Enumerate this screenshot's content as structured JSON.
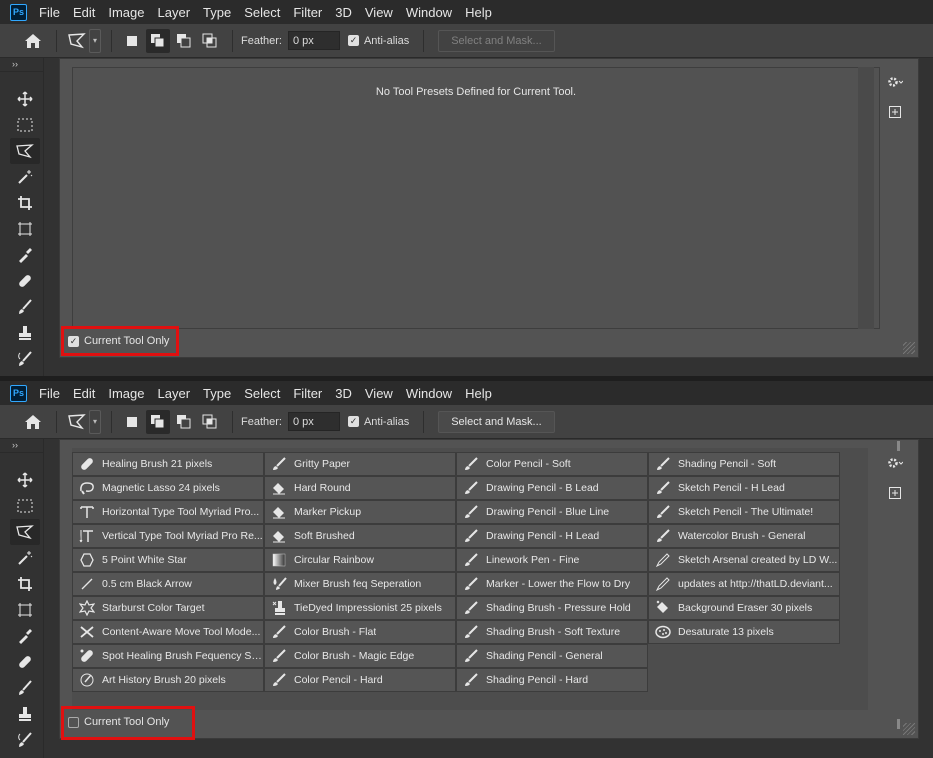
{
  "menu": [
    "File",
    "Edit",
    "Image",
    "Layer",
    "Type",
    "Select",
    "Filter",
    "3D",
    "View",
    "Window",
    "Help"
  ],
  "ps_logo": "Ps",
  "options": {
    "feather_label": "Feather:",
    "feather_value": "0 px",
    "antialias_label": "Anti-alias",
    "antialias_checked": true,
    "select_mask_label": "Select and Mask..."
  },
  "top_panel": {
    "empty_message": "No Tool Presets Defined for Current Tool.",
    "current_tool_only_label": "Current Tool Only",
    "current_tool_only_checked": true
  },
  "bottom_panel": {
    "current_tool_only_label": "Current Tool Only",
    "current_tool_only_checked": false,
    "presets": [
      {
        "label": "Healing Brush 21 pixels",
        "icon": "bandage-icon"
      },
      {
        "label": "Magnetic Lasso 24 pixels",
        "icon": "magnetic-lasso-icon"
      },
      {
        "label": "Horizontal Type Tool Myriad Pro...",
        "icon": "type-icon"
      },
      {
        "label": "Vertical Type Tool Myriad Pro Re...",
        "icon": "vertical-type-icon"
      },
      {
        "label": "5 Point White Star",
        "icon": "hexagon-icon"
      },
      {
        "label": "0.5 cm Black Arrow",
        "icon": "line-icon"
      },
      {
        "label": "Starburst Color Target",
        "icon": "starburst-icon"
      },
      {
        "label": "Content-Aware Move Tool Mode...",
        "icon": "move-cross-icon"
      },
      {
        "label": "Spot Healing Brush Fequency Se...",
        "icon": "spot-healing-icon"
      },
      {
        "label": "Art History Brush 20 pixels",
        "icon": "art-history-icon"
      },
      {
        "label": "Gritty Paper",
        "icon": "brush-icon"
      },
      {
        "label": "Hard Round",
        "icon": "eraser-icon"
      },
      {
        "label": "Marker Pickup",
        "icon": "eraser-icon"
      },
      {
        "label": "Soft Brushed",
        "icon": "eraser-icon"
      },
      {
        "label": "Circular Rainbow",
        "icon": "gradient-icon"
      },
      {
        "label": "Mixer Brush feq Seperation",
        "icon": "mixer-brush-icon"
      },
      {
        "label": "TieDyed Impressionist 25 pixels",
        "icon": "stamp-icon"
      },
      {
        "label": "Color Brush - Flat",
        "icon": "brush-icon"
      },
      {
        "label": "Color Brush - Magic Edge",
        "icon": "brush-icon"
      },
      {
        "label": "Color Pencil - Hard",
        "icon": "brush-icon"
      },
      {
        "label": "Color Pencil - Soft",
        "icon": "brush-icon"
      },
      {
        "label": "Drawing Pencil - B Lead",
        "icon": "brush-icon"
      },
      {
        "label": "Drawing Pencil - Blue Line",
        "icon": "brush-icon"
      },
      {
        "label": "Drawing Pencil - H Lead",
        "icon": "brush-icon"
      },
      {
        "label": "Linework Pen - Fine",
        "icon": "brush-icon"
      },
      {
        "label": "Marker - Lower the Flow to Dry",
        "icon": "brush-icon"
      },
      {
        "label": "Shading Brush - Pressure Hold",
        "icon": "brush-icon"
      },
      {
        "label": "Shading Brush - Soft Texture",
        "icon": "brush-icon"
      },
      {
        "label": "Shading Pencil - General",
        "icon": "brush-icon"
      },
      {
        "label": "Shading Pencil - Hard",
        "icon": "brush-icon"
      },
      {
        "label": "Shading Pencil - Soft",
        "icon": "brush-icon"
      },
      {
        "label": "Sketch Pencil - H Lead",
        "icon": "brush-icon"
      },
      {
        "label": "Sketch Pencil - The Ultimate!",
        "icon": "brush-icon"
      },
      {
        "label": "Watercolor Brush - General",
        "icon": "brush-icon"
      },
      {
        "label": "Sketch Arsenal created by LD W...",
        "icon": "pencil-icon"
      },
      {
        "label": "updates  at http://thatLD.deviant...",
        "icon": "pencil-icon"
      },
      {
        "label": "Background Eraser 30 pixels",
        "icon": "bg-eraser-icon"
      },
      {
        "label": "Desaturate 13 pixels",
        "icon": "sponge-icon"
      }
    ]
  },
  "colors": {
    "highlight": "#e01010",
    "ps_accent": "#31a8ff"
  }
}
